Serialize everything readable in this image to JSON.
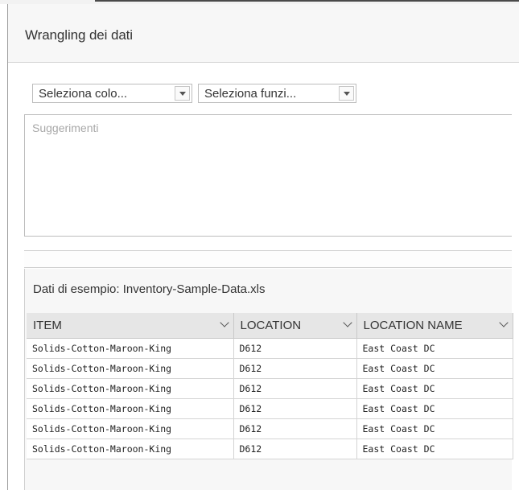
{
  "dialog": {
    "title": "Wrangling dei dati"
  },
  "controls": {
    "column_select": "Seleziona colo...",
    "function_select": "Seleziona funzi..."
  },
  "suggestions": {
    "placeholder": "Suggerimenti"
  },
  "sample": {
    "title": "Dati di esempio: Inventory-Sample-Data.xls",
    "columns": [
      "ITEM",
      "LOCATION",
      "LOCATION NAME"
    ],
    "rows": [
      [
        "Solids-Cotton-Maroon-King",
        "D612",
        "East Coast DC"
      ],
      [
        "Solids-Cotton-Maroon-King",
        "D612",
        "East Coast DC"
      ],
      [
        "Solids-Cotton-Maroon-King",
        "D612",
        "East Coast DC"
      ],
      [
        "Solids-Cotton-Maroon-King",
        "D612",
        "East Coast DC"
      ],
      [
        "Solids-Cotton-Maroon-King",
        "D612",
        "East Coast DC"
      ],
      [
        "Solids-Cotton-Maroon-King",
        "D612",
        "East Coast DC"
      ]
    ]
  }
}
